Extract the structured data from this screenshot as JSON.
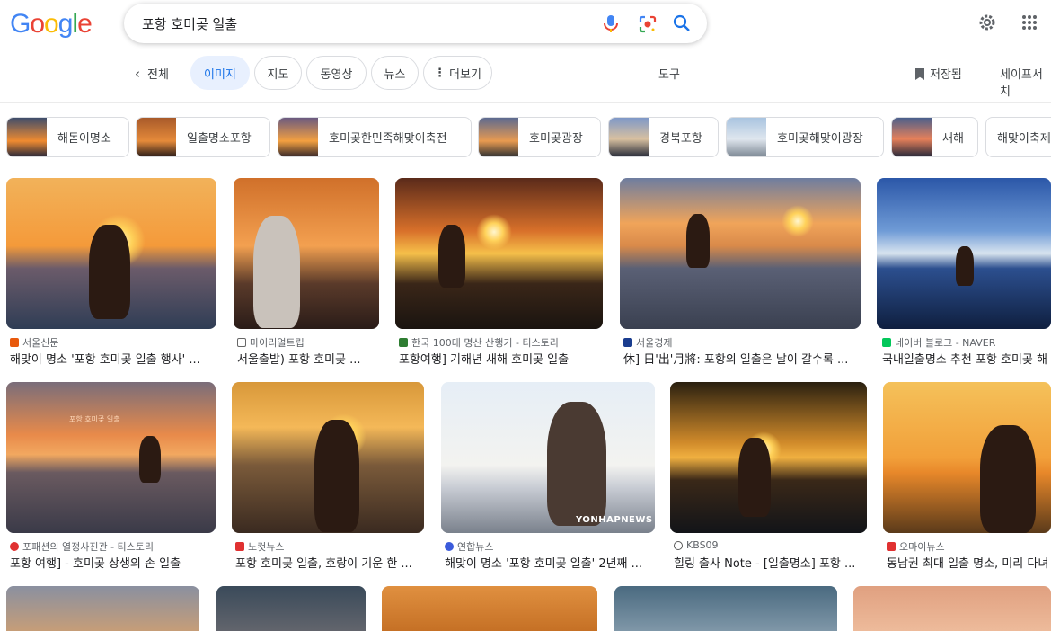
{
  "header": {
    "logo_letters": [
      "G",
      "o",
      "o",
      "g",
      "l",
      "e"
    ],
    "query": "포항 호미곶 일출"
  },
  "tabs": {
    "back_label": "전체",
    "items": [
      "이미지",
      "지도",
      "동영상",
      "뉴스",
      "더보기"
    ],
    "tools": "도구",
    "saved": "저장됨",
    "safesearch": "세이프서치"
  },
  "chips": [
    "해돋이명소",
    "일출명소포항",
    "호미곶한민족해맞이축전",
    "호미곶광장",
    "경북포항",
    "호미곶해맞이광장",
    "새해",
    "해맞이축제"
  ],
  "results_row1": [
    {
      "source": "서울신문",
      "title": "해맞이 명소 '포항 호미곶 일출 행사' ..."
    },
    {
      "source": "마이리얼트립",
      "title": "서울출발) 포항 호미곶 ..."
    },
    {
      "source": "한국 100대 명산 산행기 - 티스토리",
      "title": "포항여행] 기해년 새해 호미곶 일출"
    },
    {
      "source": "서울경제",
      "title": "休] 日'出'月將: 포항의 일출은 날이 갈수록 ..."
    },
    {
      "source": "네이버 블로그 - NAVER",
      "title": "국내일출명소 추천 포항 호미곶 해"
    }
  ],
  "results_row2": [
    {
      "source": "포패션의 열정사진관 - 티스토리",
      "title": "포항 여행] - 호미곶 상생의 손 일출"
    },
    {
      "source": "노컷뉴스",
      "title": "포항 호미곶 일출, 호랑이 기운 한 ..."
    },
    {
      "source": "연합뉴스",
      "title": "해맞이 명소 '포항 호미곶 일출' 2년째 ..."
    },
    {
      "source": "KBS09",
      "title": "힐링 출사 Note - [일출명소] 포항 ..."
    },
    {
      "source": "오마이뉴스",
      "title": "동남권 최대 일출 명소, 미리 다녀"
    }
  ],
  "watermarks": {
    "yonhap": "YONHAPNEWS",
    "overlay_text": "포항 호미곶 일출"
  },
  "colors": {
    "accent": "#1a73e8",
    "active_tab_bg": "#e8f0fe"
  }
}
